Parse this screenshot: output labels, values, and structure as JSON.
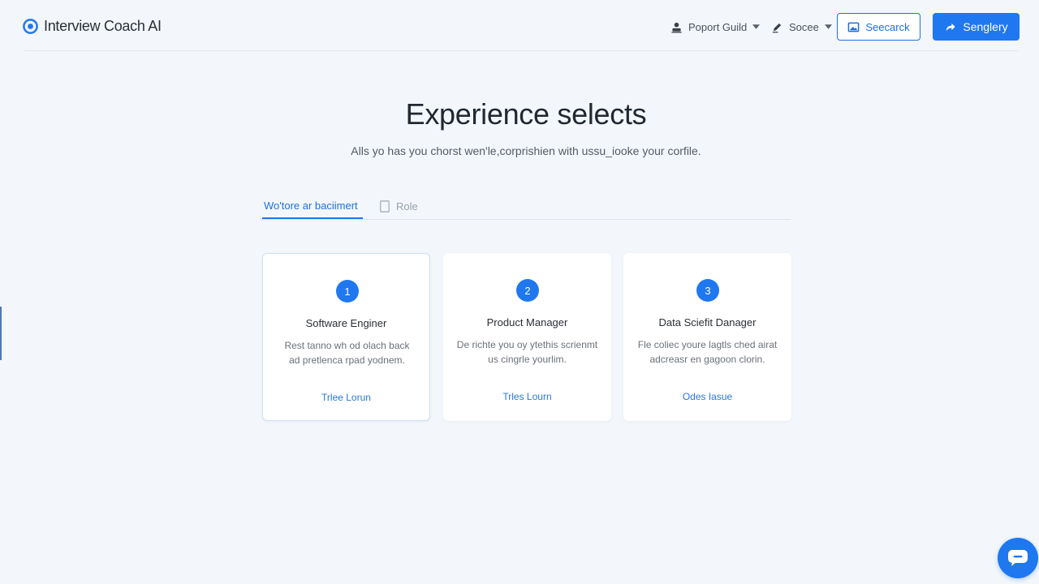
{
  "header": {
    "brand": "Interview Coach AI",
    "nav": [
      {
        "label": "Poport Guild",
        "icon": "user-icon"
      },
      {
        "label": "Socee",
        "icon": "pen-icon"
      }
    ],
    "outline_button": {
      "label": "Seecarck",
      "icon": "image-icon"
    },
    "primary_button": {
      "label": "Senglery",
      "icon": "share-arrow-icon"
    }
  },
  "hero": {
    "title": "Experience selects",
    "subtitle": "Alls yo has you chorst wen'le,corprishien with ussu_iooke your corfile."
  },
  "tabs": [
    {
      "label": "Wo'tore ar baciimert",
      "active": true
    },
    {
      "label": "Role",
      "active": false,
      "icon": "document-icon"
    }
  ],
  "cards": [
    {
      "number": "1",
      "title": "Software Enginer",
      "desc_lines": [
        "Rest tanno wh od olach back",
        "ad pretlenca rpad yodnem."
      ],
      "link": "Trlee Lorun",
      "selected": true
    },
    {
      "number": "2",
      "title": "Product Manager",
      "desc_lines": [
        "De richte you oy ytethis scrienmt",
        "us cingrle yourlim."
      ],
      "link": "Trles Lourn",
      "selected": false
    },
    {
      "number": "3",
      "title": "Data Sciefit Danager",
      "desc_lines": [
        "Fle coliec youre lagtls ched airat",
        "adcreasr en gagoon clorin."
      ],
      "link": "Odes Iasue",
      "selected": false
    }
  ],
  "colors": {
    "accent": "#1f78f0",
    "background": "#f3f7fb",
    "card": "#ffffff"
  },
  "chat_button": {
    "icon": "chat-bubble-icon"
  }
}
